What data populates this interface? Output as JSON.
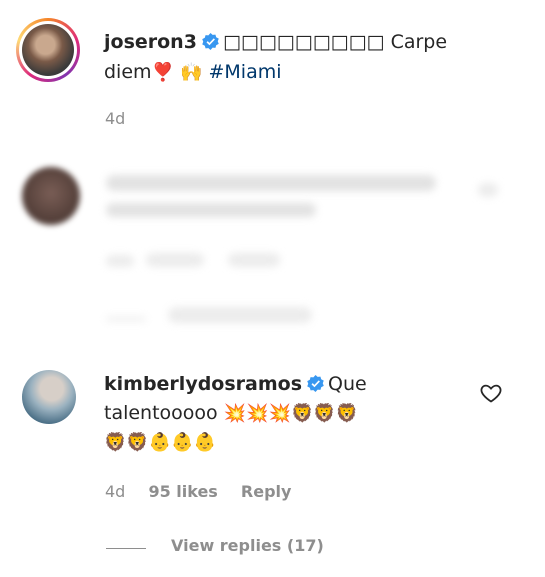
{
  "post": {
    "username": "joseron3",
    "caption_boxes": "□□□□□□□□□",
    "caption_text": "Carpe",
    "caption_line2": "diem",
    "emoji_heart": "❣️",
    "emoji_hands": "🙌",
    "hashtag": "#Miami",
    "time": "4d"
  },
  "comment": {
    "username": "kimberlydosramos",
    "text_first": "Que",
    "text_second": "talentooooo",
    "emojis_line1": "💥💥💥🦁🦁🦁",
    "emojis_line2": "🦁🦁👶👶👶",
    "time": "4d",
    "likes": "95 likes",
    "reply_label": "Reply",
    "view_replies": "View replies (17)"
  },
  "colors": {
    "verified": "#3897f0",
    "hashtag": "#00376b",
    "meta_gray": "#8e8e8e"
  }
}
